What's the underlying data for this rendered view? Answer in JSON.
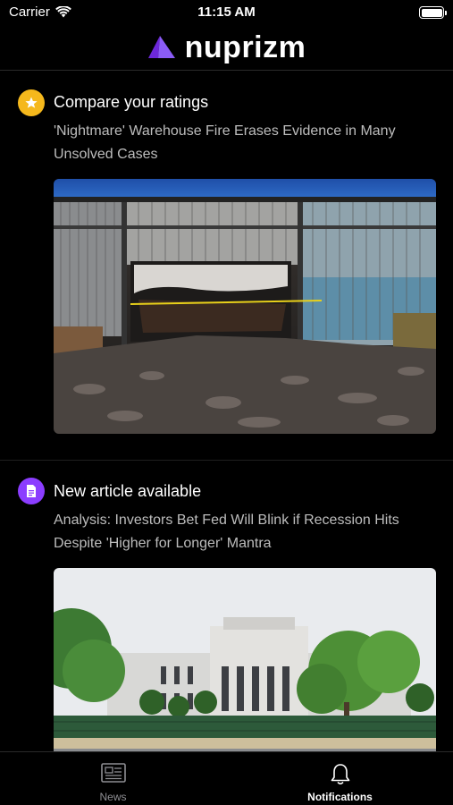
{
  "status_bar": {
    "carrier": "Carrier",
    "time": "11:15 AM"
  },
  "header": {
    "logo_text": "nuprizm",
    "brand_color": "#7c3aed"
  },
  "notifications": [
    {
      "icon": "star-icon",
      "icon_color": "#f5b81c",
      "title": "Compare your ratings",
      "description": "'Nightmare' Warehouse Fire Erases Evidence in Many Unsolved Cases",
      "image": "burned-warehouse-photo"
    },
    {
      "icon": "document-icon",
      "icon_color": "#8b3dff",
      "title": "New article available",
      "description": "Analysis: Investors Bet Fed Will Blink if Recession Hits Despite 'Higher for Longer' Mantra",
      "image": "federal-reserve-building-photo"
    }
  ],
  "tab_bar": {
    "tabs": [
      {
        "label": "News",
        "icon": "newspaper-icon",
        "active": false
      },
      {
        "label": "Notifications",
        "icon": "bell-icon",
        "active": true
      }
    ]
  }
}
